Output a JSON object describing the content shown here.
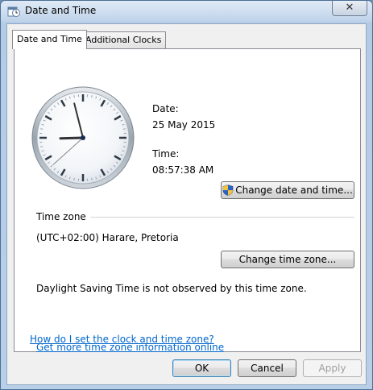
{
  "window": {
    "title": "Date and Time",
    "close_glyph": "✕"
  },
  "tabs": [
    {
      "label": "Date and Time",
      "active": true
    },
    {
      "label": "Additional Clocks",
      "active": false
    }
  ],
  "clock": {
    "hour": 8,
    "minute": 57,
    "second": 38
  },
  "date": {
    "label": "Date:",
    "value": "25 May 2015"
  },
  "time": {
    "label": "Time:",
    "value": "08:57:38 AM"
  },
  "buttons": {
    "change_date_time": "Change date and time...",
    "change_time_zone": "Change time zone...",
    "ok": "OK",
    "cancel": "Cancel",
    "apply": "Apply"
  },
  "timezone": {
    "heading": "Time zone",
    "value": "(UTC+02:00) Harare, Pretoria",
    "dst_note": "Daylight Saving Time is not observed by this time zone."
  },
  "links": {
    "more_info": "Get more time zone information online",
    "how_to": "How do I set the clock and time zone?"
  },
  "colors": {
    "link": "#0066cc",
    "accent": "#4b6f96"
  }
}
